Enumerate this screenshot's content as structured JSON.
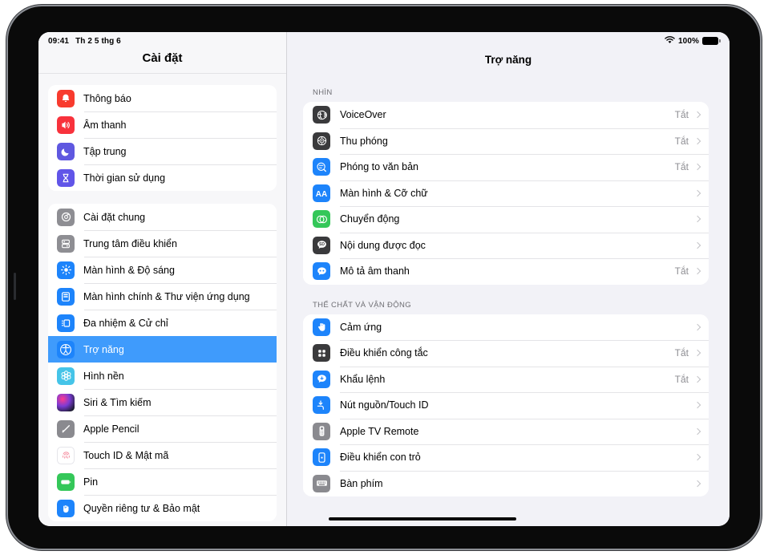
{
  "status_bar": {
    "time": "09:41",
    "date": "Th 2 5 thg 6",
    "wifi_icon": "wifi-icon",
    "battery_percent": "100%",
    "battery_icon": "battery-full-icon"
  },
  "sidebar": {
    "title": "Cài đặt",
    "groups": [
      {
        "items": [
          {
            "label": "Thông báo",
            "icon": "notifications-bell-icon",
            "icon_style": "ico-red",
            "selected": false
          },
          {
            "label": "Âm thanh",
            "icon": "sound-speaker-icon",
            "icon_style": "ico-pink-red",
            "selected": false
          },
          {
            "label": "Tập trung",
            "icon": "focus-moon-icon",
            "icon_style": "ico-indigo",
            "selected": false
          },
          {
            "label": "Thời gian sử dụng",
            "icon": "screen-time-hourglass-icon",
            "icon_style": "ico-purple",
            "selected": false
          }
        ]
      },
      {
        "items": [
          {
            "label": "Cài đặt chung",
            "icon": "general-gear-icon",
            "icon_style": "ico-gray",
            "selected": false
          },
          {
            "label": "Trung tâm điều khiển",
            "icon": "control-center-sliders-icon",
            "icon_style": "ico-gray",
            "selected": false
          },
          {
            "label": "Màn hình & Độ sáng",
            "icon": "display-brightness-sun-icon",
            "icon_style": "ico-blue",
            "selected": false
          },
          {
            "label": "Màn hình chính & Thư viện ứng dụng",
            "icon": "home-screen-app-library-icon",
            "icon_style": "ico-blue",
            "selected": false
          },
          {
            "label": "Đa nhiệm & Cử chỉ",
            "icon": "multitasking-gestures-icon",
            "icon_style": "ico-blue",
            "selected": false
          },
          {
            "label": "Trợ năng",
            "icon": "accessibility-icon",
            "icon_style": "ico-blue",
            "selected": true
          },
          {
            "label": "Hình nền",
            "icon": "wallpaper-flower-icon",
            "icon_style": "ico-cyan",
            "selected": false
          },
          {
            "label": "Siri & Tìm kiếm",
            "icon": "siri-orb-icon",
            "icon_style": "ico-gradient",
            "selected": false
          },
          {
            "label": "Apple Pencil",
            "icon": "apple-pencil-icon",
            "icon_style": "ico-dkgray",
            "selected": false
          },
          {
            "label": "Touch ID & Mật mã",
            "icon": "touch-id-fingerprint-icon",
            "icon_style": "ico-white",
            "selected": false
          },
          {
            "label": "Pin",
            "icon": "battery-icon",
            "icon_style": "ico-green",
            "selected": false
          },
          {
            "label": "Quyền riêng tư & Bảo mật",
            "icon": "privacy-hand-icon",
            "icon_style": "ico-blue",
            "selected": false
          }
        ]
      }
    ]
  },
  "detail": {
    "title": "Trợ năng",
    "sections": [
      {
        "header": "NHÌN",
        "rows": [
          {
            "label": "VoiceOver",
            "value": "Tắt",
            "icon": "voiceover-icon",
            "icon_style": "ico-dark"
          },
          {
            "label": "Thu phóng",
            "value": "Tắt",
            "icon": "zoom-icon",
            "icon_style": "ico-dark"
          },
          {
            "label": "Phóng to văn bản",
            "value": "Tắt",
            "icon": "magnifier-text-icon",
            "icon_style": "ico-blue"
          },
          {
            "label": "Màn hình & Cỡ chữ",
            "value": "",
            "icon": "display-text-size-aa-icon",
            "icon_style": "ico-blue"
          },
          {
            "label": "Chuyển động",
            "value": "",
            "icon": "motion-contrast-circles-icon",
            "icon_style": "ico-green"
          },
          {
            "label": "Nội dung được đọc",
            "value": "",
            "icon": "spoken-content-bubble-icon",
            "icon_style": "ico-dark"
          },
          {
            "label": "Mô tả âm thanh",
            "value": "Tắt",
            "icon": "audio-description-bubble-icon",
            "icon_style": "ico-blue"
          }
        ]
      },
      {
        "header": "THỂ CHẤT VÀ VẬN ĐỘNG",
        "rows": [
          {
            "label": "Cảm ứng",
            "value": "",
            "icon": "touch-hand-icon",
            "icon_style": "ico-blue"
          },
          {
            "label": "Điều khiển công tắc",
            "value": "Tắt",
            "icon": "switch-control-grid-icon",
            "icon_style": "ico-dark"
          },
          {
            "label": "Khẩu lệnh",
            "value": "Tắt",
            "icon": "voice-control-bubble-icon",
            "icon_style": "ico-blue"
          },
          {
            "label": "Nút nguồn/Touch ID",
            "value": "",
            "icon": "side-button-touch-id-icon",
            "icon_style": "ico-blue"
          },
          {
            "label": "Apple TV Remote",
            "value": "",
            "icon": "apple-tv-remote-icon",
            "icon_style": "ico-dkgray"
          },
          {
            "label": "Điều khiển con trỏ",
            "value": "",
            "icon": "pointer-control-icon",
            "icon_style": "ico-blue"
          },
          {
            "label": "Bàn phím",
            "value": "",
            "icon": "keyboard-icon",
            "icon_style": "ico-dkgray"
          }
        ]
      }
    ]
  },
  "colors": {
    "accent_blue": "#3f9bfc",
    "page_background": "#f2f2f7",
    "card_background": "#ffffff",
    "secondary_text": "#8e8e93"
  }
}
